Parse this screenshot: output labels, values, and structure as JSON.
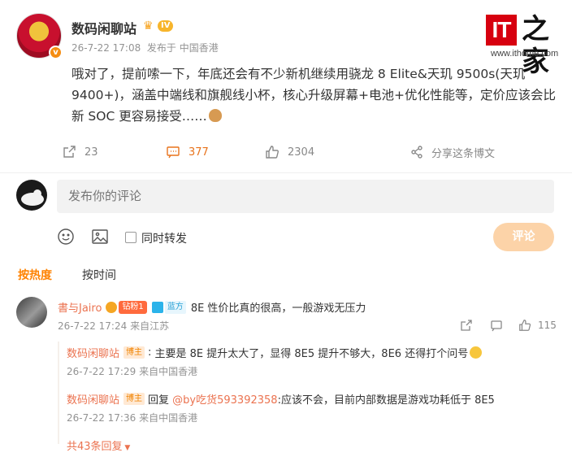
{
  "watermark": {
    "logo_text": "IT",
    "logo_glyph": "之家",
    "url": "www.ithome.com"
  },
  "post": {
    "author": "数码闲聊站",
    "level": "IV",
    "time": "26-7-22 17:08",
    "source": "发布于 中国香港",
    "text": "哦对了，提前嗦一下，年底还会有不少新机继续用骁龙 8 Elite&天玑 9500s(天玑 9400+)，涵盖中端线和旗舰线小杯，核心升级屏幕+电池+优化性能等，定价应该会比新 SOC 更容易接受……",
    "reposts": "23",
    "comments": "377",
    "likes": "2304",
    "share_label": "分享这条博文"
  },
  "composer": {
    "placeholder": "发布你的评论",
    "repost_label": "同时转发",
    "submit_label": "评论"
  },
  "sort": {
    "hot": "按热度",
    "time": "按时间"
  },
  "comments": [
    {
      "author": "書与Jairo",
      "fans_tag": "钻粉1",
      "blue_tag": "蓝方",
      "text": "8E 性价比真的很高，一般游戏无压力",
      "time": "26-7-22 17:24",
      "location": "来自江苏",
      "likes": "115",
      "replies": [
        {
          "author": "数码闲聊站",
          "host_tag": "博主",
          "text": "主要是 8E 提升太大了，显得 8E5 提升不够大，8E6 还得打个问号",
          "time": "26-7-22 17:29",
          "location": "来自中国香港"
        },
        {
          "author": "数码闲聊站",
          "host_tag": "博主",
          "reply_prefix": "回复",
          "mention": "@by吃货593392358",
          "text": ":应该不会，目前内部数据是游戏功耗低于 8E5",
          "time": "26-7-22 17:36",
          "location": "来自中国香港"
        }
      ],
      "more_replies": "共43条回复"
    }
  ],
  "colors": {
    "accent": "#ff8200",
    "username": "#eb7350",
    "brand_red": "#d7000f"
  },
  "icons": [
    "repost-icon",
    "comment-icon",
    "like-icon",
    "share-icon",
    "emoji-icon",
    "image-icon",
    "crown-icon",
    "chevron-down-icon"
  ]
}
